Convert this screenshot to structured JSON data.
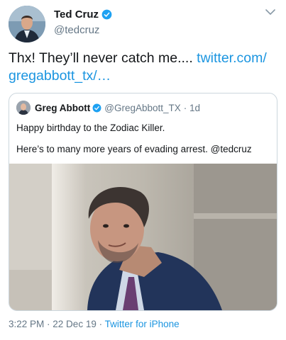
{
  "author": {
    "display_name": "Ted Cruz",
    "handle": "@tedcruz",
    "verified": true
  },
  "tweet": {
    "text": "Thx!  They’ll never catch me.... ",
    "link_text": "twitter.com/\ngregabbott_tx/…"
  },
  "quoted_tweet": {
    "display_name": "Greg Abbott",
    "handle": "@GregAbbott_TX",
    "age": "· 1d",
    "verified": true,
    "line1": "Happy birthday to the Zodiac Killer.",
    "line2": "Here’s to many more years of evading arrest. @tedcruz"
  },
  "meta": {
    "time": "3:22 PM",
    "date": "· 22 Dec 19 ·",
    "source": "Twitter for iPhone"
  },
  "colors": {
    "link": "#1b95e0",
    "verified": "#1da1f2",
    "secondary_text": "#657786",
    "border": "#ccd6dd"
  },
  "icons": [
    "verified-badge-icon",
    "chevron-down-icon"
  ]
}
